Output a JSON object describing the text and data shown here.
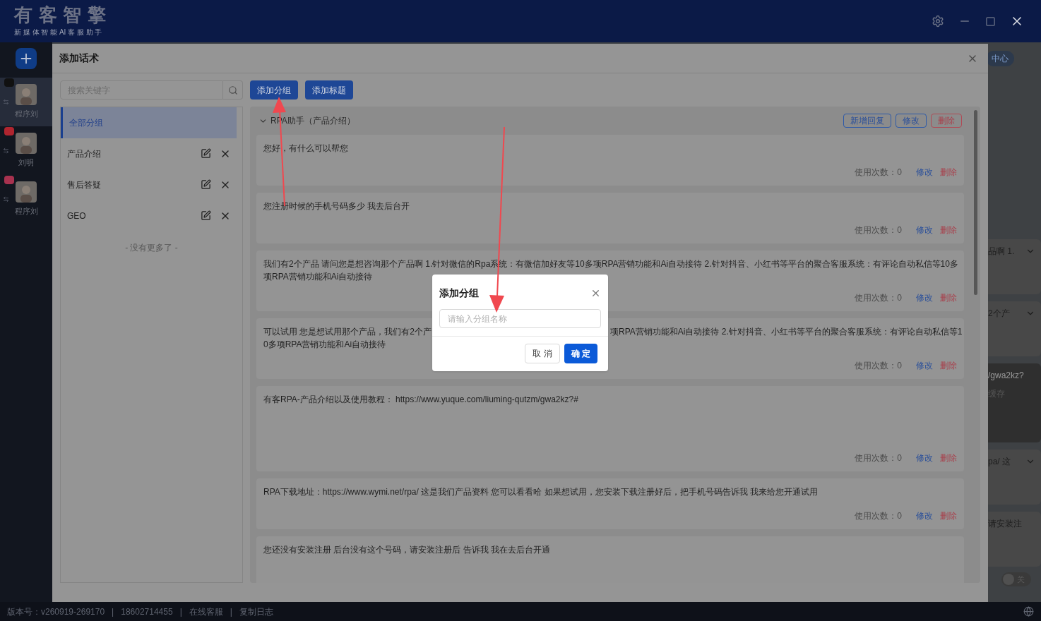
{
  "app": {
    "logo": "有 客 智 擎",
    "tagline": "新 媒 体 智 能 AI 客 服 助 手"
  },
  "accounts": [
    {
      "name": "程序刘",
      "color": "#111111",
      "selected": true
    },
    {
      "name": "刘明",
      "color": "#b0252f",
      "selected": false
    },
    {
      "name": "程序刘",
      "color": "#a8324f",
      "selected": false
    }
  ],
  "behind": {
    "pill": "中心",
    "items": [
      {
        "text": "品啊 1.",
        "kind": "collapsed"
      },
      {
        "text": "2个产",
        "kind": "collapsed"
      },
      {
        "text": "/gwa2kz?",
        "kind": "dark",
        "extra": "缓存"
      },
      {
        "text": "pa/ 这",
        "kind": "collapsed"
      },
      {
        "text": "请安装注",
        "kind": "plain"
      }
    ],
    "toggle": {
      "label": "关",
      "on": false
    }
  },
  "status_bar": [
    "版本号：v260919-269170",
    "|",
    "18602714455",
    "|",
    "在线客服",
    "|",
    "复制日志"
  ],
  "modal": {
    "title": "添加话术",
    "search": {
      "placeholder": "搜索关键字"
    },
    "toolbar": [
      "添加分组",
      "添加标题"
    ],
    "groups": [
      {
        "name": "全部分组",
        "selected": true,
        "editable": false
      },
      {
        "name": "产品介绍",
        "selected": false,
        "editable": true
      },
      {
        "name": "售后答疑",
        "selected": false,
        "editable": true
      },
      {
        "name": "GEO",
        "selected": false,
        "editable": true
      }
    ],
    "end_note": "- 没有更多了 -",
    "section": {
      "title": "RPA助手（产品介绍）",
      "expanded": true,
      "actions": [
        {
          "label": "新增回复",
          "kind": "primary"
        },
        {
          "label": "修改",
          "kind": "primary"
        },
        {
          "label": "删除",
          "kind": "danger"
        }
      ]
    },
    "replies": [
      {
        "lines": [
          "您好，有什么可以帮您"
        ],
        "usage": "使用次数：0",
        "edit": "修改",
        "delete": "删除"
      },
      {
        "lines": [
          "您注册时候的手机号码多少 我去后台开"
        ],
        "usage": "使用次数：0",
        "edit": "修改",
        "delete": "删除"
      },
      {
        "lines": [
          "我们有2个产品 请问您是想咨询那个产品啊 1.针对微信的Rpa系统：有微信加好友等10多项RPA营销功能和Ai自动接待 2.针对抖音、小红书等平台的聚合客服系统：有评论自动私信等10多",
          "项RPA营销功能和Ai自动接待"
        ],
        "usage": "使用次数：0",
        "edit": "修改",
        "delete": "删除"
      },
      {
        "split": [
          "可以试用 您是想试用那个产品，我们有2个产",
          "项RPA营销功能和Ai自动接待 2.针对抖音、小红书等平台的聚合客服系统：有评论自动私信等1"
        ],
        "lines": [
          "0多项RPA营销功能和Ai自动接待"
        ],
        "usage": "使用次数：0",
        "edit": "修改",
        "delete": "删除"
      },
      {
        "lines": [
          "有客RPA-产品介绍以及使用教程： https://www.yuque.com/liuming-qutzm/gwa2kz?#"
        ],
        "tall": true,
        "usage": "使用次数：0",
        "edit": "修改",
        "delete": "删除"
      },
      {
        "lines": [
          "RPA下载地址：https://www.wymi.net/rpa/ 这是我们产品资料 您可以看看哈 如果想试用，您安装下载注册好后，把手机号码告诉我 我来给您开通试用"
        ],
        "usage": "使用次数：0",
        "edit": "修改",
        "delete": "删除"
      },
      {
        "lines": [
          "您还没有安装注册 后台没有这个号码，请安装注册后 告诉我 我在去后台开通"
        ]
      }
    ]
  },
  "dialog": {
    "title": "添加分组",
    "placeholder": "请输入分组名称",
    "buttons": [
      {
        "label": "取 消",
        "kind": "default"
      },
      {
        "label": "确 定",
        "kind": "primary"
      }
    ]
  }
}
